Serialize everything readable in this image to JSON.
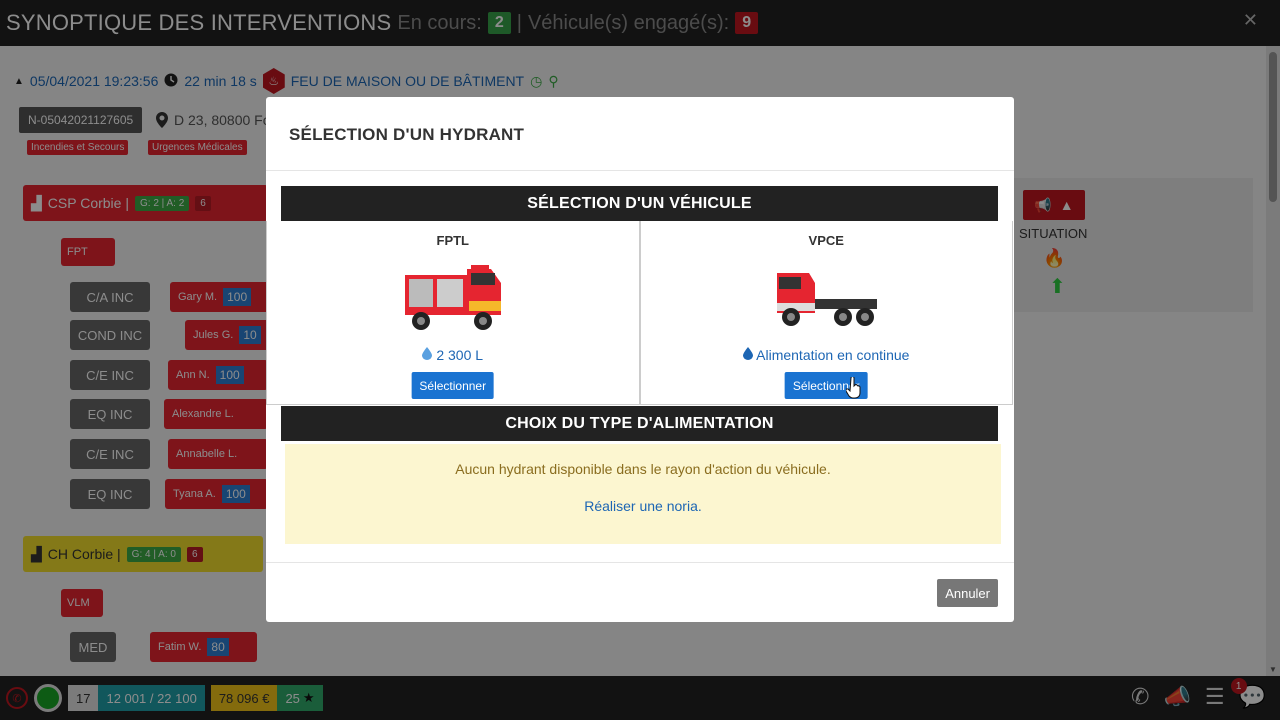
{
  "topbar": {
    "title": "SYNOPTIQUE DES INTERVENTIONS",
    "en_cours_label": "En cours:",
    "en_cours_count": "2",
    "separator": "|",
    "vehicles_label": "Véhicule(s) engagé(s):",
    "vehicles_count": "9",
    "close_glyph": "✕"
  },
  "incident": {
    "datetime": "05/04/2021 19:23:56",
    "duration": "22 min 18 s",
    "type": "FEU DE MAISON OU DE BÂTIMENT",
    "id": "N-05042021127605",
    "address": "D 23, 80800 Fo",
    "tags": [
      "Incendies et Secours",
      "Urgences Médicales"
    ]
  },
  "stations": [
    {
      "name": "CSP Corbie |",
      "g": "G: 2 | A: 2",
      "n": "6"
    },
    {
      "name": "CH Corbie |",
      "g": "G: 4 | A: 0",
      "n": "6"
    }
  ],
  "vehicle_chips": [
    "FPT",
    "VLM"
  ],
  "roles": [
    "C/A INC",
    "COND INC",
    "C/E INC",
    "EQ INC",
    "C/E INC",
    "EQ INC",
    "MED"
  ],
  "personnel": [
    {
      "name": "Gary M.",
      "score": "100"
    },
    {
      "name": "Jules G.",
      "score": "10"
    },
    {
      "name": "Ann N.",
      "score": "100"
    },
    {
      "name": "Alexandre L.",
      "score": ""
    },
    {
      "name": "Annabelle L.",
      "score": ""
    },
    {
      "name": "Tyana A.",
      "score": "100"
    },
    {
      "name": "Fatim W.",
      "score": "80"
    }
  ],
  "situation": {
    "label": "SITUATION"
  },
  "bottombar": {
    "count": "17",
    "capacity": "12 001 / 22 100",
    "money": "78 096 €",
    "stars": "25",
    "chat_badge": "1"
  },
  "modal": {
    "title": "SÉLECTION D'UN HYDRANT",
    "vehicle_section": "SÉLECTION D'UN VÉHICULE",
    "vehicles": [
      {
        "name": "FPTL",
        "water": "2 300 L",
        "button": "Sélectionner"
      },
      {
        "name": "VPCE",
        "water": "Alimentation en continue",
        "button": "Sélectionner"
      }
    ],
    "supply_section": "CHOIX DU TYPE D'ALIMENTATION",
    "no_hydrant_msg": "Aucun hydrant disponible dans le rayon d'action du véhicule.",
    "noria_link": "Réaliser une noria.",
    "cancel": "Annuler"
  },
  "colors": {
    "accent_blue": "#1a73d1",
    "danger_red": "#e52530",
    "success_green": "#38a34a"
  }
}
